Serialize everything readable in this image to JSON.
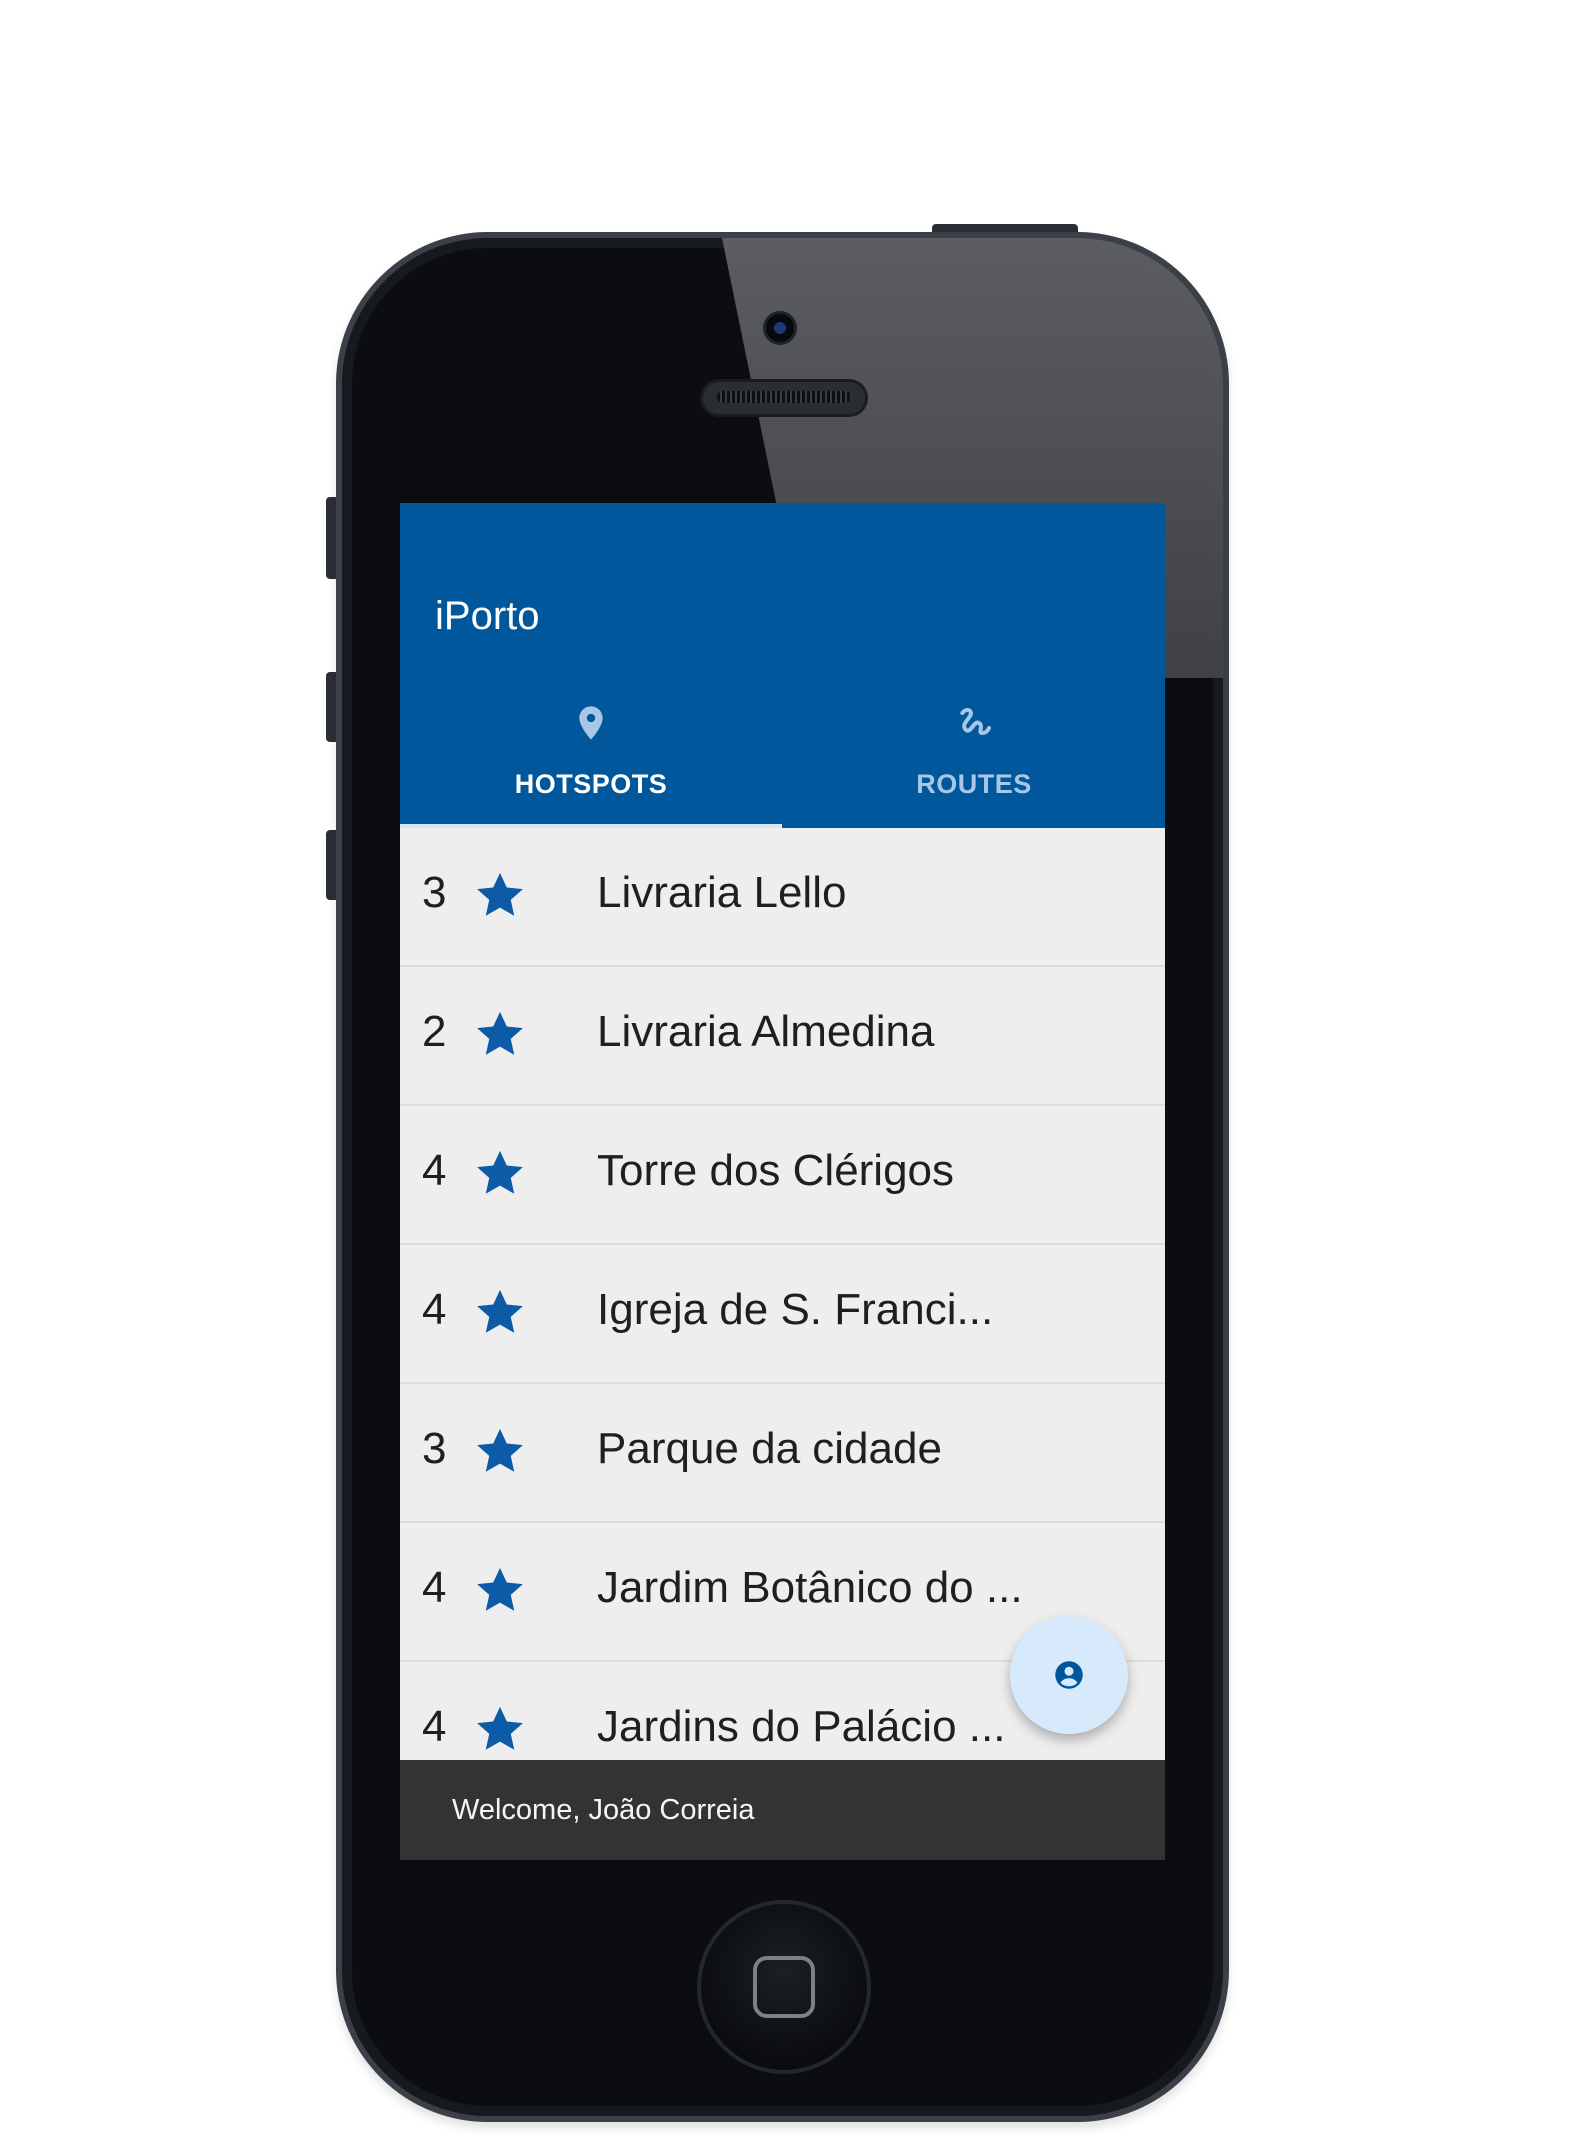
{
  "app": {
    "title": "iPorto",
    "accent_color": "#01579b",
    "star_color": "#0d5aa7"
  },
  "tabs": [
    {
      "label": "HOTSPOTS",
      "icon": "map-pin-icon",
      "selected": true
    },
    {
      "label": "ROUTES",
      "icon": "route-icon",
      "selected": false
    }
  ],
  "hotspots": [
    {
      "rating": "3",
      "name": "Livraria Lello"
    },
    {
      "rating": "2",
      "name": "Livraria Almedina"
    },
    {
      "rating": "4",
      "name": "Torre dos Clérigos"
    },
    {
      "rating": "4",
      "name": "Igreja de S. Franci..."
    },
    {
      "rating": "3",
      "name": "Parque da cidade"
    },
    {
      "rating": "4",
      "name": "Jardim Botânico do ..."
    },
    {
      "rating": "4",
      "name": "Jardins do Palácio ..."
    }
  ],
  "fab": {
    "icon": "account-circle-icon"
  },
  "snackbar": {
    "message": "Welcome, João Correia"
  }
}
